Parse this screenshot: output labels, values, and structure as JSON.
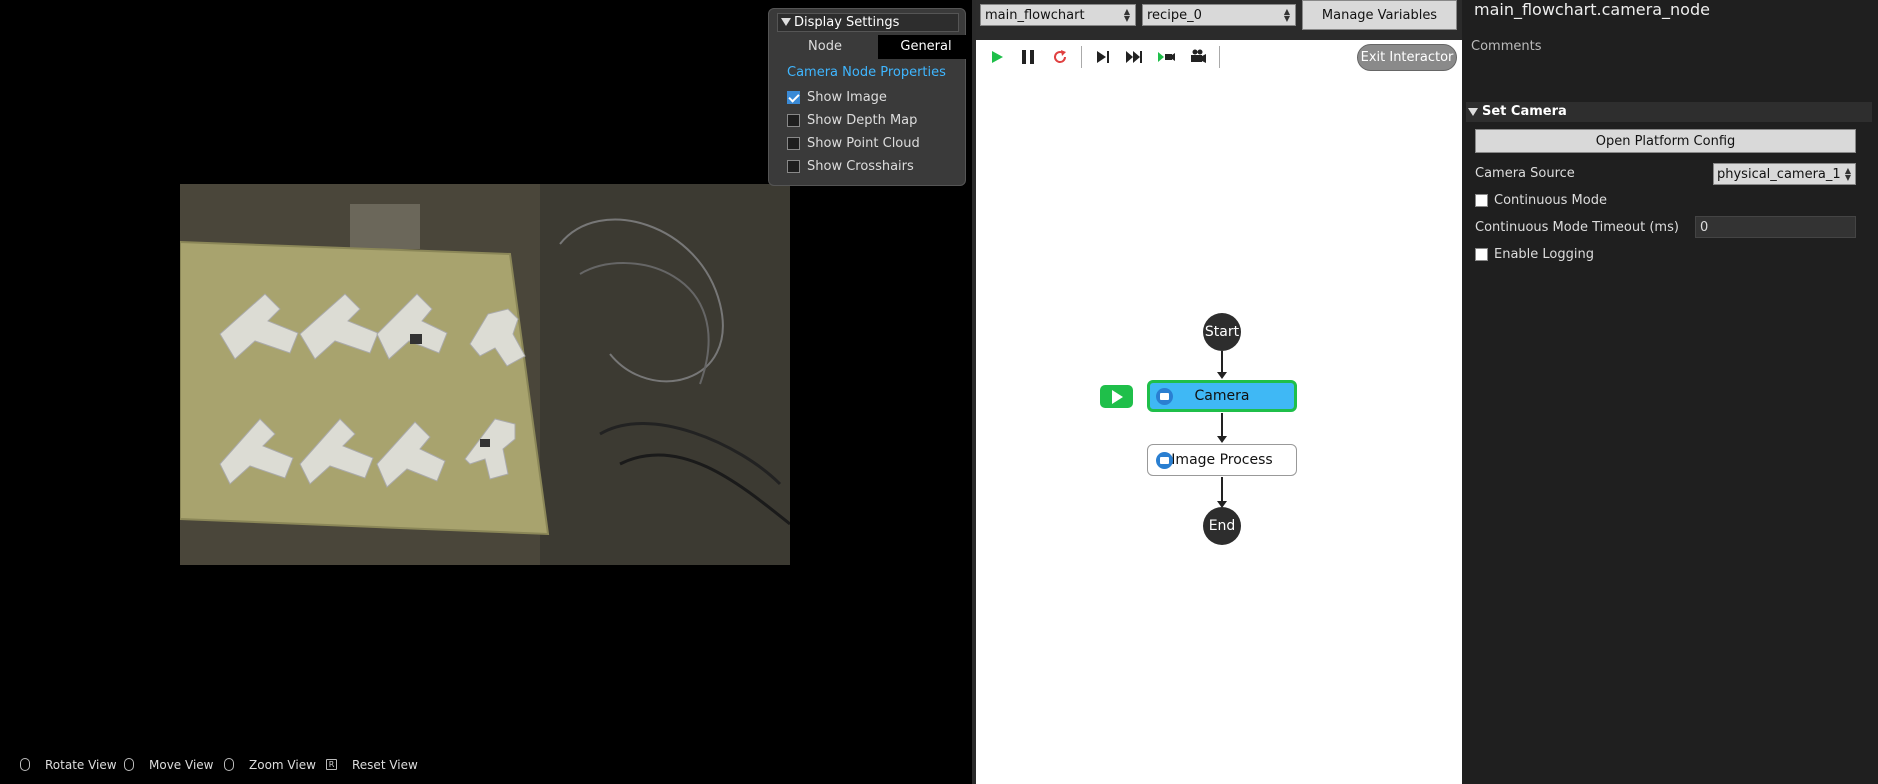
{
  "viewport": {
    "display_settings": {
      "title": "Display Settings",
      "tabs": [
        "Node",
        "General"
      ],
      "active_tab": "General",
      "section_title": "Camera Node Properties",
      "options": [
        {
          "label": "Show Image",
          "checked": true
        },
        {
          "label": "Show Depth Map",
          "checked": false
        },
        {
          "label": "Show Point Cloud",
          "checked": false
        },
        {
          "label": "Show Crosshairs",
          "checked": false
        }
      ]
    },
    "hints": {
      "rotate": "Rotate View",
      "move": "Move View",
      "zoom": "Zoom View",
      "reset": "Reset View",
      "reset_key": "R"
    }
  },
  "editor": {
    "flowchart_select": "main_flowchart",
    "recipe_select": "recipe_0",
    "manage_variables": "Manage Variables",
    "exit_interactor": "Exit Interactor",
    "toolbar_icons": [
      "play-icon",
      "pause-icon",
      "reload-icon",
      "step-icon",
      "step-all-icon",
      "run-to-icon",
      "camera-capture-icon"
    ],
    "nodes": {
      "start": "Start",
      "camera": "Camera",
      "image_process": "Image Process",
      "end": "End"
    },
    "colors": {
      "active_node": "#3fb8f5",
      "active_border": "#1fbf4a",
      "run_indicator": "#1fbf4a"
    }
  },
  "properties": {
    "title": "main_flowchart.camera_node",
    "comments_label": "Comments",
    "section": "Set Camera",
    "open_platform_config": "Open Platform Config",
    "camera_source_label": "Camera Source",
    "camera_source_value": "physical_camera_1",
    "continuous_mode_label": "Continuous Mode",
    "continuous_mode": false,
    "timeout_label": "Continuous Mode Timeout (ms)",
    "timeout_value": "0",
    "enable_logging_label": "Enable Logging",
    "enable_logging": false
  }
}
